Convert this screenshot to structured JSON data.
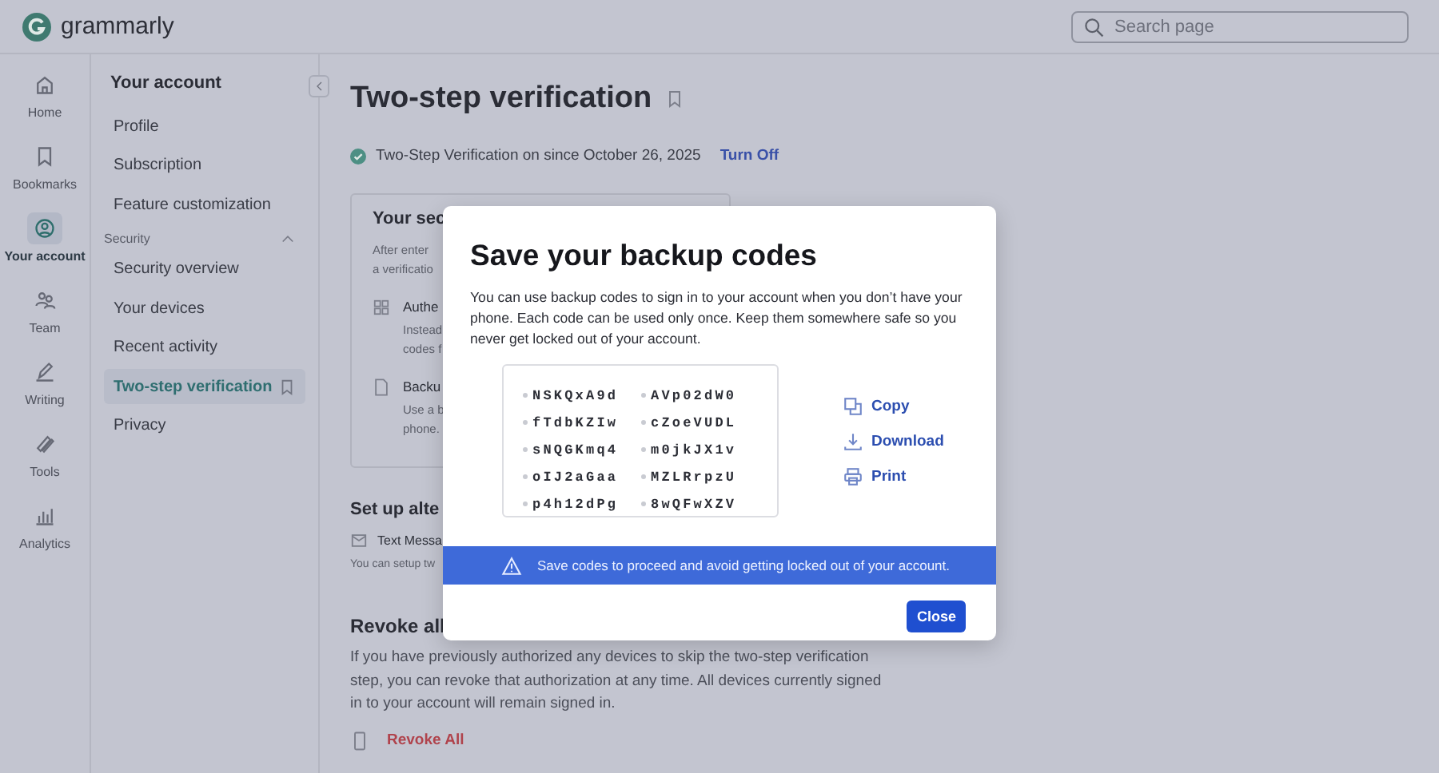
{
  "header": {
    "logo": "grammarly",
    "search": {
      "placeholder": "Search page"
    }
  },
  "rail": [
    {
      "label": "Home",
      "selected": false
    },
    {
      "label": "Bookmarks",
      "selected": false
    },
    {
      "label": "Your account",
      "selected": true
    },
    {
      "label": "Team",
      "selected": false
    },
    {
      "label": "Writing",
      "selected": false
    },
    {
      "label": "Tools",
      "selected": false
    },
    {
      "label": "Analytics",
      "selected": false
    }
  ],
  "sidebar": {
    "title": "Your account",
    "items": [
      {
        "label": "Profile",
        "selected": false
      },
      {
        "label": "Subscription",
        "selected": false
      },
      {
        "label": "Feature customization",
        "selected": false
      }
    ],
    "section": {
      "label": "Security",
      "expanded": true,
      "items": [
        {
          "label": "Security overview",
          "selected": false
        },
        {
          "label": "Your devices",
          "selected": false
        },
        {
          "label": "Recent activity",
          "selected": false
        },
        {
          "label": "Two-step verification",
          "selected": true
        },
        {
          "label": "Privacy",
          "selected": false
        }
      ]
    }
  },
  "main": {
    "title": "Two-step verification",
    "status": {
      "text": "Two-Step Verification on since October 26, 2025",
      "action": "Turn Off"
    },
    "card": {
      "title": "Your sec",
      "intro": [
        "After enter",
        "a verificatio"
      ],
      "options": [
        {
          "title": "Authe",
          "desc": [
            "Instead",
            "codes f"
          ]
        },
        {
          "title": "Backu",
          "desc": [
            "Use a b",
            "phone."
          ]
        }
      ]
    },
    "alternate": {
      "title": "Set up alte",
      "option": "Text Messa",
      "desc": "You can setup tw"
    },
    "revoke": {
      "title": "Revoke all",
      "text": "If you have previously authorized any devices to skip the two-step verification step, you can revoke that authorization at any time. All devices currently signed in to your account will remain signed in.",
      "action": "Revoke All"
    }
  },
  "modal": {
    "title": "Save your backup codes",
    "text": "You can use backup codes to sign in to your account when you don’t have your phone. Each code can be used only once. Keep them somewhere safe so you never get locked out of your account.",
    "codes": [
      "NSKQxA9d",
      "AVp02dW0",
      "fTdbKZIw",
      "cZoeVUDL",
      "sNQGKmq4",
      "m0jkJX1v",
      "oIJ2aGaa",
      "MZLRrpzU",
      "p4h12dPg",
      "8wQFwXZV"
    ],
    "actions": [
      "Copy",
      "Download",
      "Print"
    ],
    "warning": "Save codes to proceed and avoid getting locked out of your account.",
    "close": "Close"
  }
}
